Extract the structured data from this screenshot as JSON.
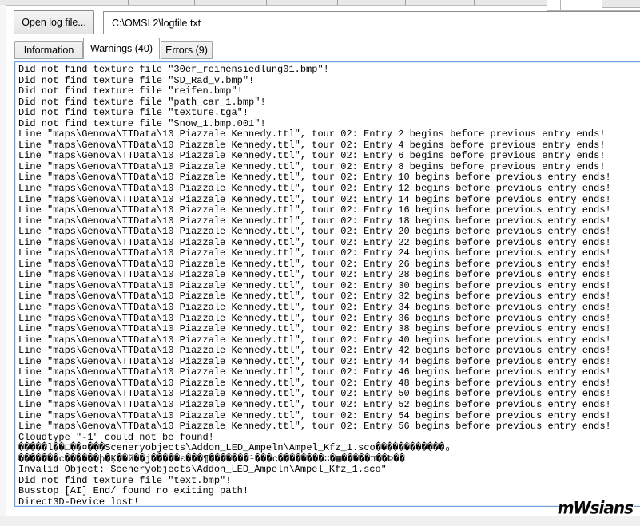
{
  "toolbar": {
    "open_button_label": "Open log file...",
    "file_path": "C:\\OMSI 2\\logfile.txt"
  },
  "tabs": [
    {
      "label": "Information",
      "active": false
    },
    {
      "label": "Warnings (40)",
      "active": true
    },
    {
      "label": "Errors (9)",
      "active": false
    }
  ],
  "log": {
    "lines": [
      "Did not find texture file \"30er_reihensiedlung01.bmp\"!",
      "Did not find texture file \"SD_Rad_v.bmp\"!",
      "Did not find texture file \"reifen.bmp\"!",
      "Did not find texture file \"path_car_1.bmp\"!",
      "Did not find texture file \"texture.tga\"!",
      "Did not find texture file \"Snow_1.bmp.001\"!",
      "Line \"maps\\Genova\\TTData\\10 Piazzale Kennedy.ttl\", tour 02: Entry 2 begins before previous entry ends!",
      "Line \"maps\\Genova\\TTData\\10 Piazzale Kennedy.ttl\", tour 02: Entry 4 begins before previous entry ends!",
      "Line \"maps\\Genova\\TTData\\10 Piazzale Kennedy.ttl\", tour 02: Entry 6 begins before previous entry ends!",
      "Line \"maps\\Genova\\TTData\\10 Piazzale Kennedy.ttl\", tour 02: Entry 8 begins before previous entry ends!",
      "Line \"maps\\Genova\\TTData\\10 Piazzale Kennedy.ttl\", tour 02: Entry 10 begins before previous entry ends!",
      "Line \"maps\\Genova\\TTData\\10 Piazzale Kennedy.ttl\", tour 02: Entry 12 begins before previous entry ends!",
      "Line \"maps\\Genova\\TTData\\10 Piazzale Kennedy.ttl\", tour 02: Entry 14 begins before previous entry ends!",
      "Line \"maps\\Genova\\TTData\\10 Piazzale Kennedy.ttl\", tour 02: Entry 16 begins before previous entry ends!",
      "Line \"maps\\Genova\\TTData\\10 Piazzale Kennedy.ttl\", tour 02: Entry 18 begins before previous entry ends!",
      "Line \"maps\\Genova\\TTData\\10 Piazzale Kennedy.ttl\", tour 02: Entry 20 begins before previous entry ends!",
      "Line \"maps\\Genova\\TTData\\10 Piazzale Kennedy.ttl\", tour 02: Entry 22 begins before previous entry ends!",
      "Line \"maps\\Genova\\TTData\\10 Piazzale Kennedy.ttl\", tour 02: Entry 24 begins before previous entry ends!",
      "Line \"maps\\Genova\\TTData\\10 Piazzale Kennedy.ttl\", tour 02: Entry 26 begins before previous entry ends!",
      "Line \"maps\\Genova\\TTData\\10 Piazzale Kennedy.ttl\", tour 02: Entry 28 begins before previous entry ends!",
      "Line \"maps\\Genova\\TTData\\10 Piazzale Kennedy.ttl\", tour 02: Entry 30 begins before previous entry ends!",
      "Line \"maps\\Genova\\TTData\\10 Piazzale Kennedy.ttl\", tour 02: Entry 32 begins before previous entry ends!",
      "Line \"maps\\Genova\\TTData\\10 Piazzale Kennedy.ttl\", tour 02: Entry 34 begins before previous entry ends!",
      "Line \"maps\\Genova\\TTData\\10 Piazzale Kennedy.ttl\", tour 02: Entry 36 begins before previous entry ends!",
      "Line \"maps\\Genova\\TTData\\10 Piazzale Kennedy.ttl\", tour 02: Entry 38 begins before previous entry ends!",
      "Line \"maps\\Genova\\TTData\\10 Piazzale Kennedy.ttl\", tour 02: Entry 40 begins before previous entry ends!",
      "Line \"maps\\Genova\\TTData\\10 Piazzale Kennedy.ttl\", tour 02: Entry 42 begins before previous entry ends!",
      "Line \"maps\\Genova\\TTData\\10 Piazzale Kennedy.ttl\", tour 02: Entry 44 begins before previous entry ends!",
      "Line \"maps\\Genova\\TTData\\10 Piazzale Kennedy.ttl\", tour 02: Entry 46 begins before previous entry ends!",
      "Line \"maps\\Genova\\TTData\\10 Piazzale Kennedy.ttl\", tour 02: Entry 48 begins before previous entry ends!",
      "Line \"maps\\Genova\\TTData\\10 Piazzale Kennedy.ttl\", tour 02: Entry 50 begins before previous entry ends!",
      "Line \"maps\\Genova\\TTData\\10 Piazzale Kennedy.ttl\", tour 02: Entry 52 begins before previous entry ends!",
      "Line \"maps\\Genova\\TTData\\10 Piazzale Kennedy.ttl\", tour 02: Entry 54 begins before previous entry ends!",
      "Line \"maps\\Genova\\TTData\\10 Piazzale Kennedy.ttl\", tour 02: Entry 56 begins before previous entry ends!",
      "Cloudtype \"-1\" could not be found!",
      "�����l��□��¤���Sceneryobjects\\Addon_LED_Ampeln\\Ampel_Kfz_1.sco������������ₒ",
      "�������c������þ�Ķ��й��j�����є���¶�������¹���c��������∷�▦�����π��Þ��",
      "Invalid Object: Sceneryobjects\\Addon_LED_Ampeln\\Ampel_Kfz_1.sco\"",
      "Did not find texture file \"text.bmp\"!",
      "Busstop [AI] End/ found no exiting path!",
      "Direct3D-Device lost!"
    ]
  },
  "watermark": "mWsians",
  "colors": {
    "log_border": "#6f9fd2",
    "button_face": "#e9e9e9",
    "frame_border": "#a6a6a6"
  }
}
